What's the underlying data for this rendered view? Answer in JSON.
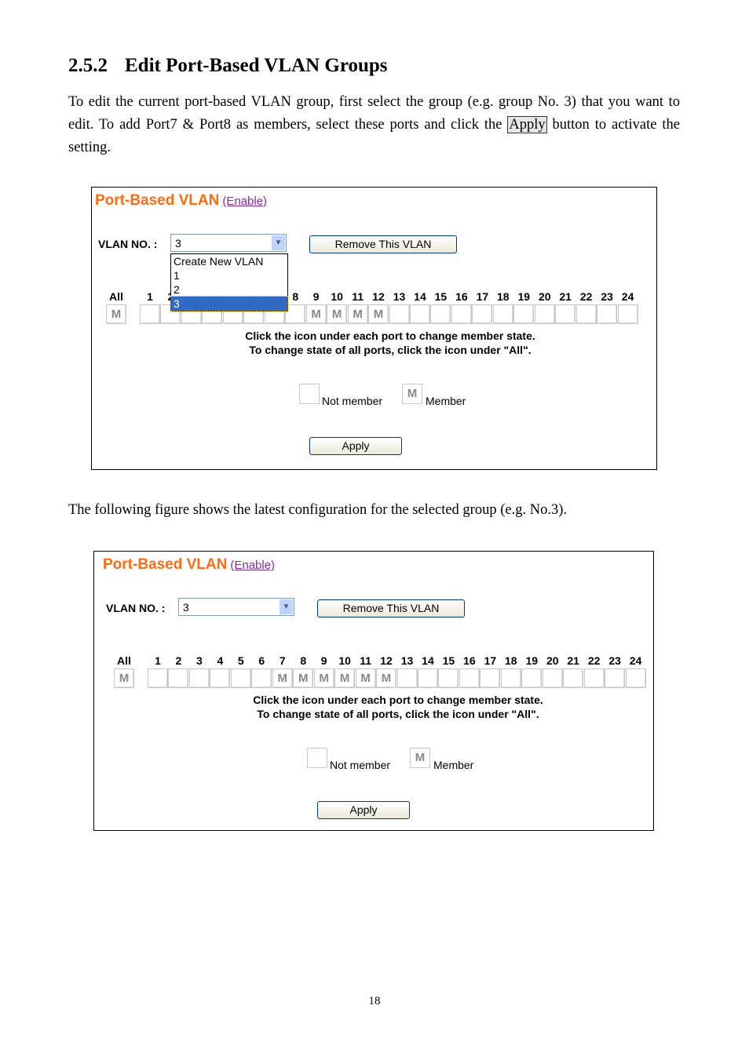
{
  "section": {
    "number": "2.5.2",
    "title": "Edit Port-Based VLAN Groups"
  },
  "para1": {
    "before": "To edit the current port-based VLAN group, first select the group (e.g. group No. 3) that you want to edit. To add Port7 & Port8 as members, select these ports and click the ",
    "apply": "Apply",
    "after": " button to activate the setting."
  },
  "para2": "The following figure shows the latest configuration for the selected group (e.g. No.3).",
  "ui": {
    "title": "Port-Based VLAN",
    "enable": "(Enable)",
    "vlan_label": "VLAN NO. :",
    "remove": "Remove This VLAN",
    "all": "All",
    "member_mark": "M",
    "instr1": "Click the icon under each port to change member state.",
    "instr2": "To change state of all ports, click the icon under \"All\".",
    "not_member": "Not member",
    "member": "Member",
    "apply": "Apply"
  },
  "figures": [
    {
      "selected": "3",
      "dropdown_open": true,
      "options": [
        "Create New VLAN",
        "1",
        "2",
        "3"
      ],
      "all_member": true,
      "members": [
        9,
        10,
        11,
        12
      ]
    },
    {
      "selected": "3",
      "dropdown_open": false,
      "options": [
        "Create New VLAN",
        "1",
        "2",
        "3"
      ],
      "all_member": true,
      "members": [
        7,
        8,
        9,
        10,
        11,
        12
      ]
    }
  ],
  "ports": [
    1,
    2,
    3,
    4,
    5,
    6,
    7,
    8,
    9,
    10,
    11,
    12,
    13,
    14,
    15,
    16,
    17,
    18,
    19,
    20,
    21,
    22,
    23,
    24
  ],
  "page_number": "18"
}
